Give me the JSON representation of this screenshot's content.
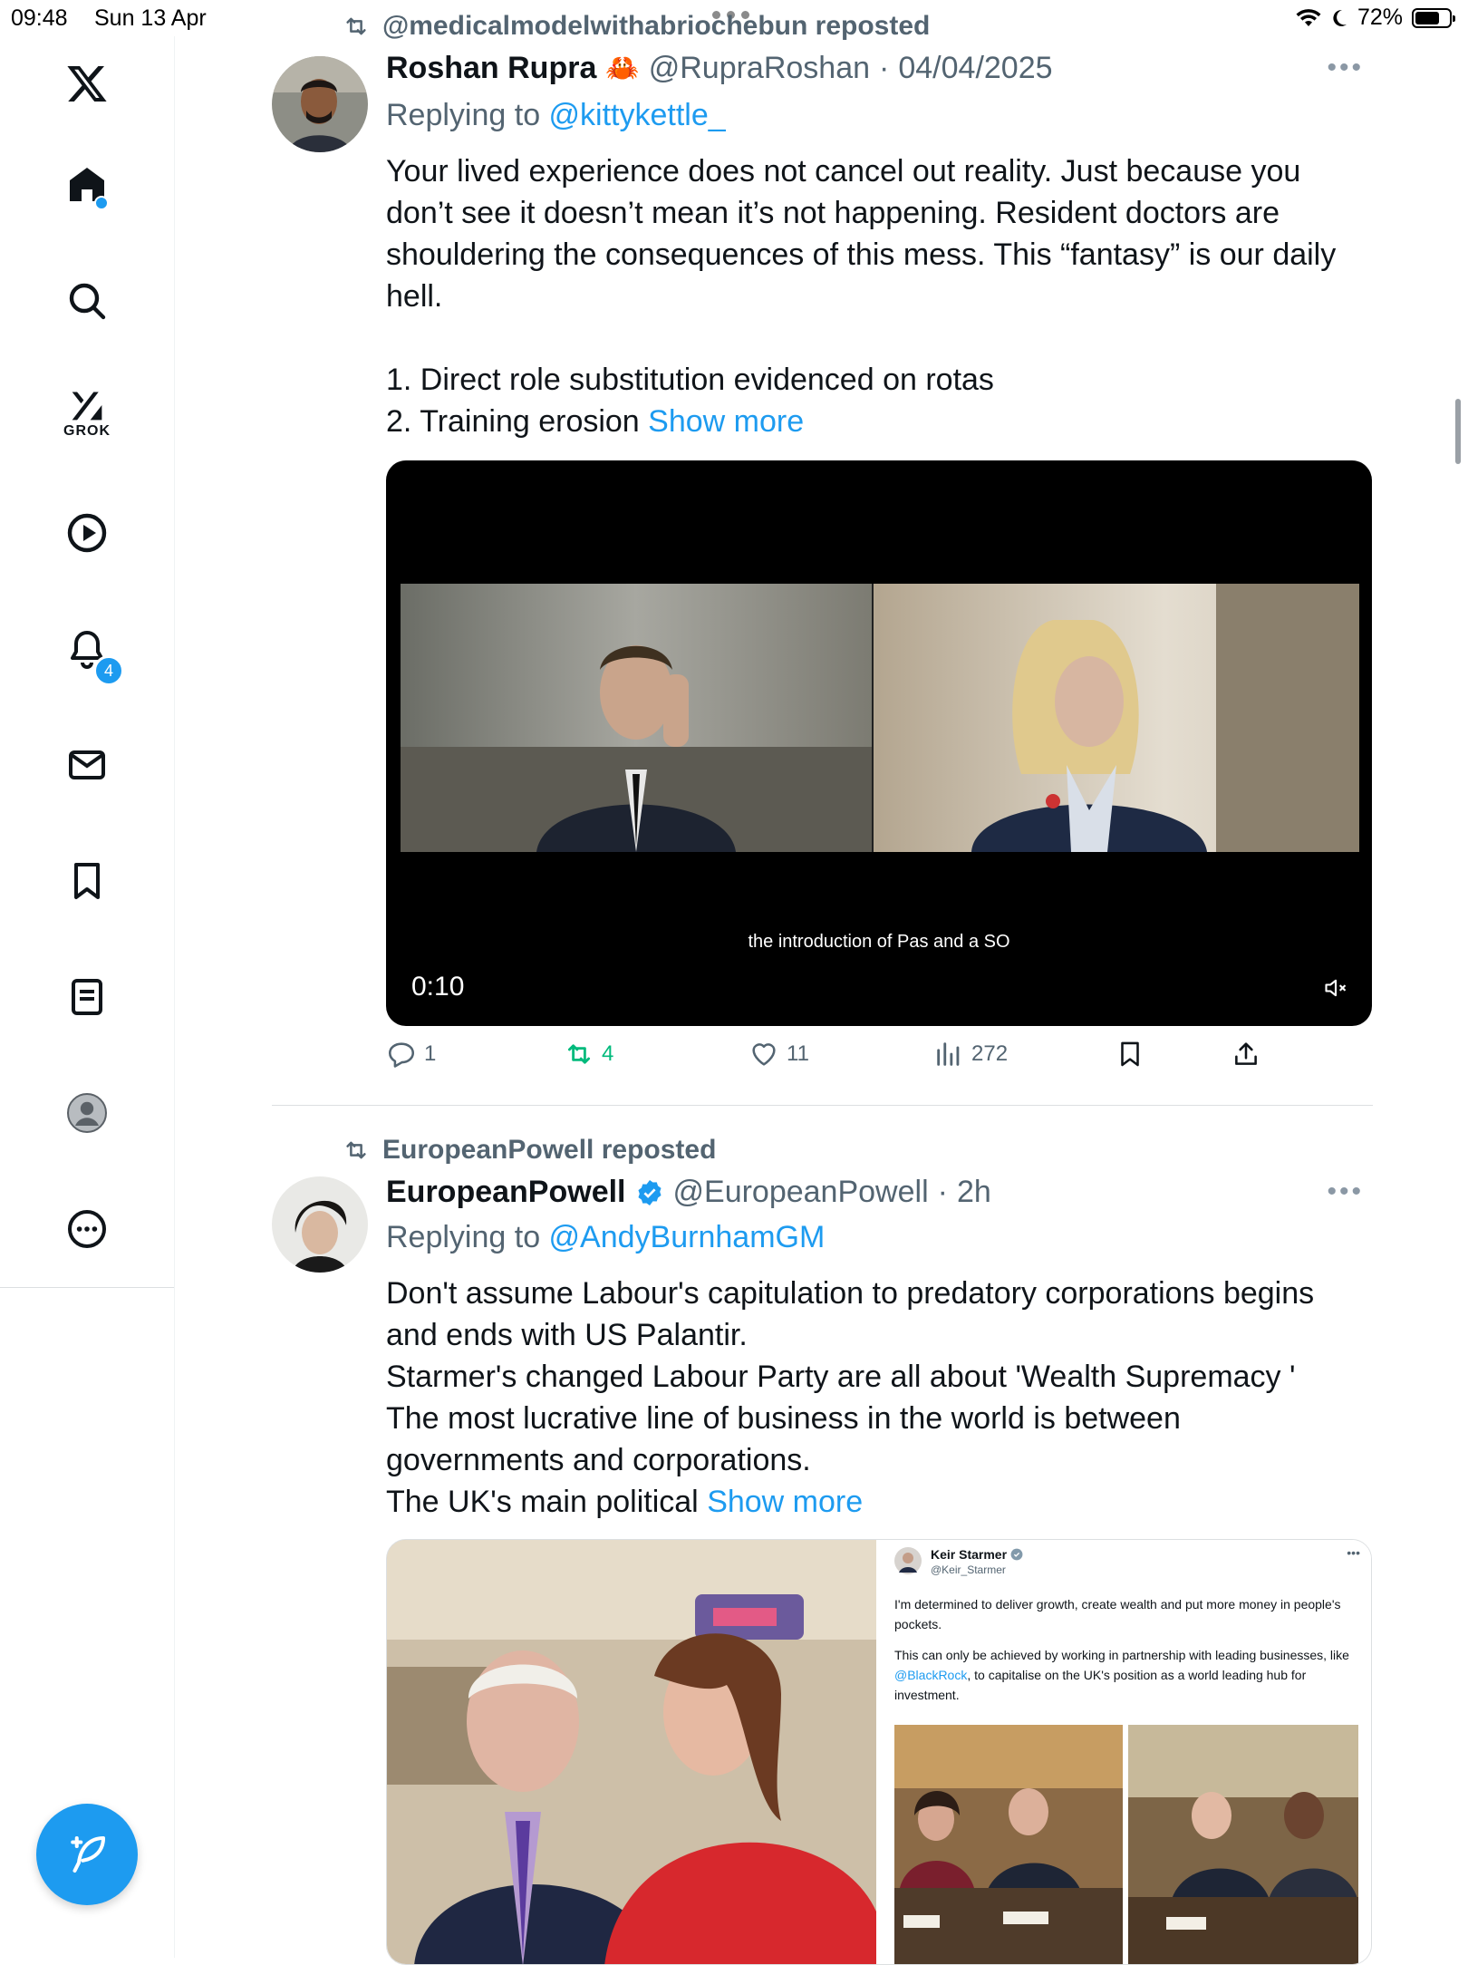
{
  "status_bar": {
    "time": "09:48",
    "date": "Sun 13 Apr",
    "battery": "72%",
    "battery_level": 0.72
  },
  "sidebar": {
    "grok_label": "GROK",
    "notifications_badge": "4",
    "items": [
      "x-logo",
      "home",
      "search",
      "grok",
      "video",
      "notifications",
      "messages",
      "bookmarks",
      "lists",
      "profile",
      "more"
    ]
  },
  "tweets": [
    {
      "repost_text": "@medicalmodelwithabriochebun reposted",
      "name": "Roshan Rupra",
      "emoji": "🦀",
      "handle": "@RupraRoshan",
      "time": "04/04/2025",
      "replying_prefix": "Replying to ",
      "replying_handle": "@kittykettle_",
      "lines": [
        "Your lived experience does not cancel out reality. Just because you",
        "don’t see it doesn’t mean it’s not happening. Resident doctors are",
        "shouldering the consequences of this mess. This “fantasy” is our daily",
        "hell.",
        "",
        "1. Direct role substitution evidenced on rotas"
      ],
      "last_line": "2. Training erosion ",
      "show_more": "Show more",
      "video": {
        "caption": "the introduction of Pas and a SO",
        "duration": "0:10"
      },
      "stats": {
        "replies": "1",
        "reposts": "4",
        "likes": "11",
        "views": "272"
      }
    },
    {
      "repost_text": "EuropeanPowell reposted",
      "name": "EuropeanPowell",
      "handle": "@EuropeanPowell",
      "time": "2h",
      "replying_prefix": "Replying to ",
      "replying_handle": "@AndyBurnhamGM",
      "lines": [
        "Don't assume Labour's capitulation to predatory corporations begins",
        "and ends with US Palantir.",
        "Starmer's changed Labour Party are all about 'Wealth Supremacy '",
        "The most lucrative line of business in the world is between",
        "governments and corporations."
      ],
      "last_line": "The UK's main political ",
      "show_more": "Show more",
      "embedded": {
        "name": "Keir Starmer",
        "handle": "@Keir_Starmer",
        "para1": "I'm determined to deliver growth, create wealth and put more money in people's pockets.",
        "para2_a": "This can only be achieved by working in partnership with leading businesses, like ",
        "para2_link": "@BlackRock",
        "para2_b": ", to capitalise on the UK's position as a world leading hub for investment."
      }
    }
  ],
  "colors": {
    "accent": "#1d9bf0",
    "repost_green": "#00ba7c",
    "muted": "#536471"
  }
}
